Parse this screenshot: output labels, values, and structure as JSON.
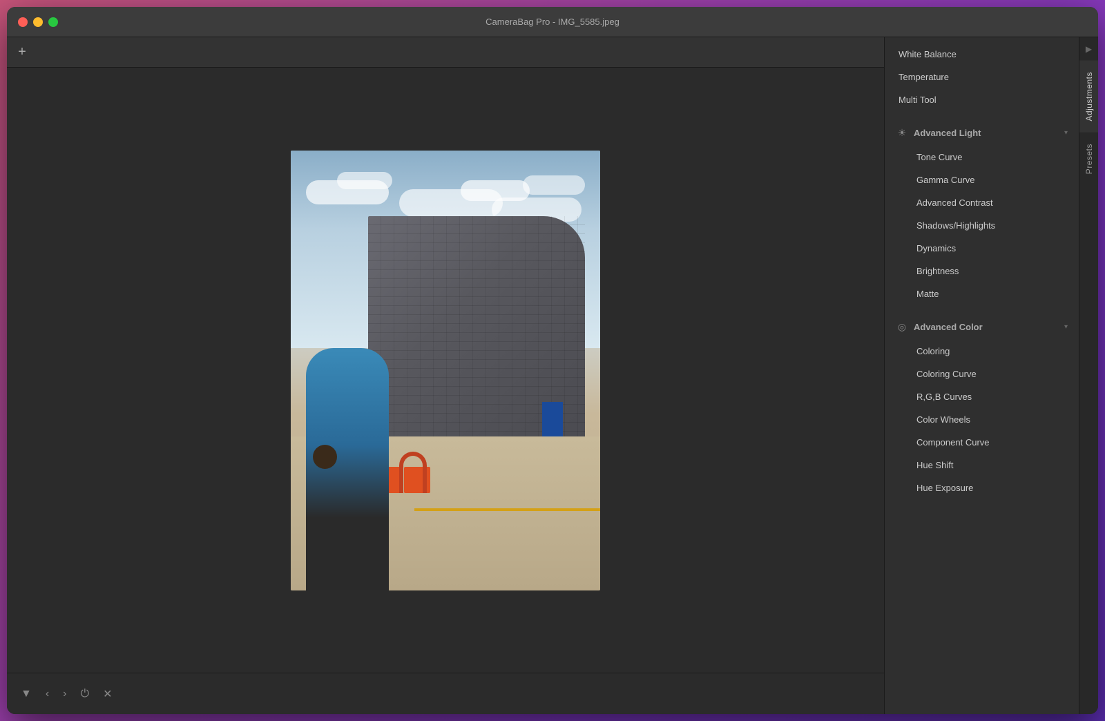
{
  "window": {
    "title": "CameraBag Pro - IMG_5585.jpeg"
  },
  "toolbar": {
    "add_button": "+",
    "bottom_buttons": [
      "▼",
      "‹",
      "›",
      "⏻",
      "✕"
    ]
  },
  "right_panel": {
    "sections": [
      {
        "id": "advanced_light",
        "icon": "☀",
        "title": "Advanced Light",
        "expanded": true,
        "items": [
          "Tone Curve",
          "Gamma Curve",
          "Advanced Contrast",
          "Shadows/Highlights",
          "Dynamics",
          "Brightness",
          "Matte"
        ]
      },
      {
        "id": "advanced_color",
        "icon": "◎",
        "title": "Advanced Color",
        "expanded": true,
        "items": [
          "Coloring",
          "Coloring Curve",
          "R,G,B Curves",
          "Color Wheels",
          "Component Curve",
          "Hue Shift",
          "Hue Exposure"
        ]
      }
    ],
    "top_items": [
      "White Balance",
      "Temperature",
      "Multi Tool"
    ],
    "side_tabs": [
      {
        "id": "adjustments",
        "label": "Adjustments",
        "active": true
      },
      {
        "id": "presets",
        "label": "Presets",
        "active": false
      }
    ]
  }
}
